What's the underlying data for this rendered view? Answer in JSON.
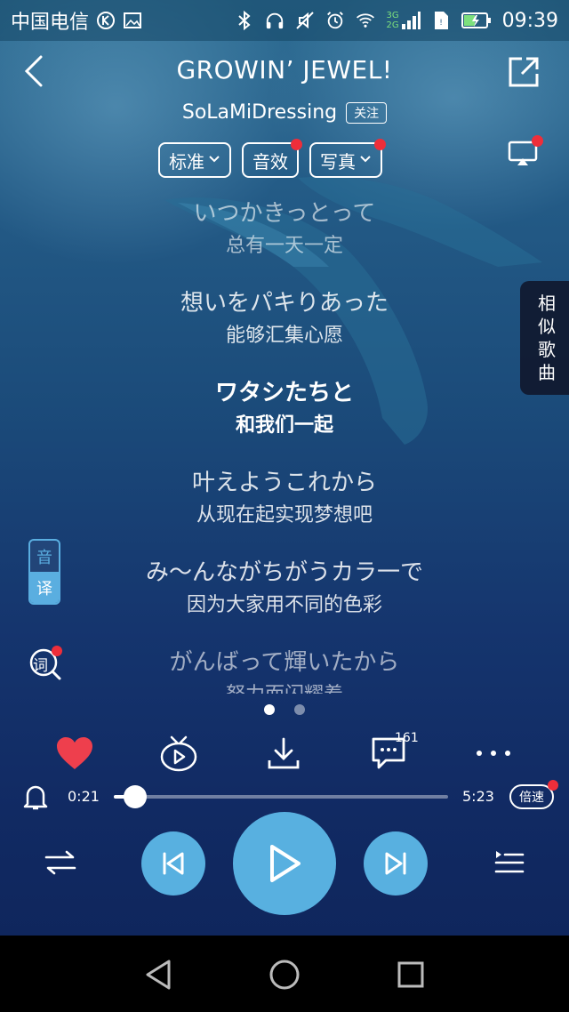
{
  "status_bar": {
    "carrier": "中国电信",
    "network_top": "3G",
    "network_bottom": "2G",
    "time": "09:39"
  },
  "header": {
    "title": "GROWIN’ JEWEL!",
    "artist": "SoLaMiDressing",
    "follow_label": "关注"
  },
  "chips": [
    {
      "label": "标准",
      "has_caret": true,
      "badge": false
    },
    {
      "label": "音效",
      "has_caret": false,
      "badge": true
    },
    {
      "label": "写真",
      "has_caret": true,
      "badge": true
    }
  ],
  "lyrics": [
    {
      "jp": "いつかきっとって",
      "cn": "总有一天一定",
      "state": "dim"
    },
    {
      "jp": "想いをパキりあった",
      "cn": "能够汇集心愿",
      "state": "mid"
    },
    {
      "jp": "ワタシたちと",
      "cn": "和我们一起",
      "state": "current"
    },
    {
      "jp": "叶えようこれから",
      "cn": "从现在起实现梦想吧",
      "state": "mid"
    },
    {
      "jp": "み〜んながちがうカラ一で",
      "cn": "因为大家用不同的色彩",
      "state": "mid"
    },
    {
      "jp": "がんばって輝いたから",
      "cn": "努力而闪耀着",
      "state": "dim"
    }
  ],
  "side_tab": {
    "chars": [
      "相",
      "似",
      "歌",
      "曲"
    ]
  },
  "yinyi": {
    "top": "音",
    "bottom": "译"
  },
  "ci_icon_label": "词",
  "pager": {
    "count": 2,
    "active": 0
  },
  "actions": {
    "comment_count": "161"
  },
  "progress": {
    "current": "0:21",
    "total": "5:23",
    "fraction": 0.065,
    "speed_label": "倍速"
  },
  "colors": {
    "accent": "#58b0e0",
    "like": "#ee3f4d",
    "badge": "#ee2e3a"
  },
  "icons": {
    "back": "chevron-left-icon",
    "share": "share-icon",
    "cast": "cast-icon",
    "like": "heart-icon",
    "video": "tv-play-icon",
    "download": "download-icon",
    "comment": "comment-icon",
    "more": "more-icon",
    "bell": "bell-icon",
    "shuffle": "play-order-icon",
    "prev": "previous-icon",
    "play": "play-icon",
    "next": "next-icon",
    "playlist": "playlist-icon"
  }
}
